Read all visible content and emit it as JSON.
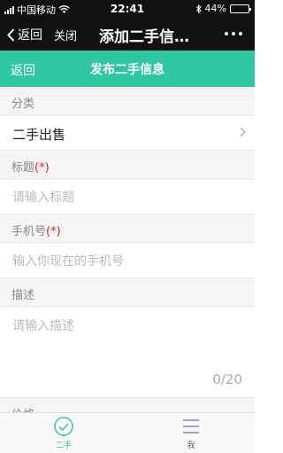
{
  "status_bar": {
    "carrier": "中国移动",
    "time": "22:41",
    "battery_text": "44%",
    "battery_level": 0.44
  },
  "nav_bar": {
    "back_label": "返回",
    "close_label": "关闭",
    "title": "添加二手信…"
  },
  "header": {
    "back_label": "返回",
    "title": "发布二手信息"
  },
  "form": {
    "category": {
      "label": "分类",
      "value": "二手出售"
    },
    "title": {
      "label": "标题",
      "required_mark": "(*)",
      "placeholder": "请输入标题"
    },
    "phone": {
      "label": "手机号",
      "required_mark": "(*)",
      "placeholder": "输入你现在的手机号"
    },
    "description": {
      "label": "描述",
      "placeholder": "请输入描述",
      "counter": "0/20"
    },
    "price": {
      "label": "价格"
    }
  },
  "tab_bar": {
    "items": [
      {
        "label": "二手",
        "icon": "check-circle-icon",
        "active": true
      },
      {
        "label": "我",
        "icon": "menu-icon",
        "active": false
      }
    ],
    "accent_color": "#2ec7a1"
  },
  "colors": {
    "header_bg": "#2ec7a1",
    "nav_bg": "#111111",
    "required": "#e02020"
  }
}
